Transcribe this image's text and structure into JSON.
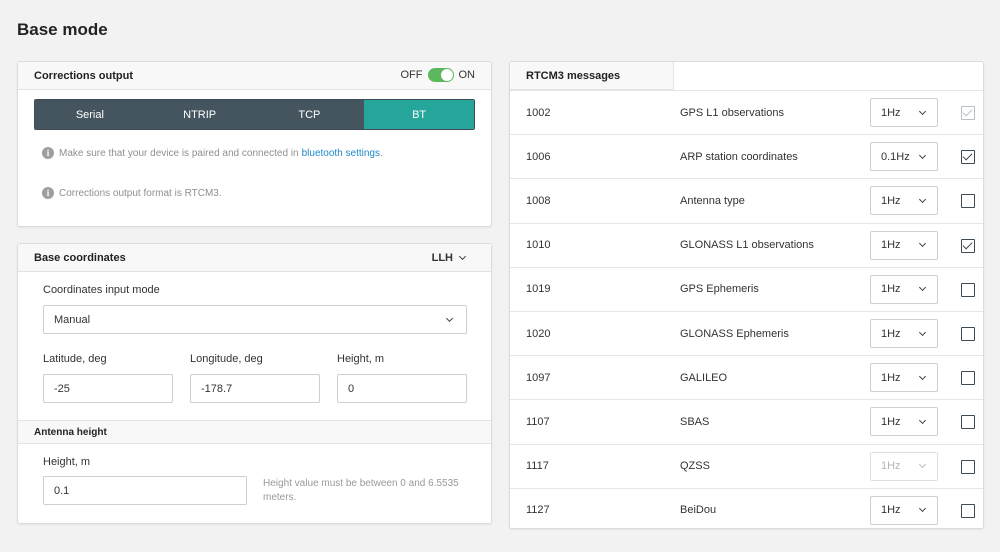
{
  "page": {
    "title": "Base mode"
  },
  "corrections": {
    "title": "Corrections output",
    "toggle_off": "OFF",
    "toggle_on": "ON",
    "tabs": [
      "Serial",
      "NTRIP",
      "TCP",
      "BT"
    ],
    "active_tab": "BT",
    "info1_text": "Make sure that your device is paired and connected in",
    "info1_link": "bluetooth settings",
    "info1_end": ".",
    "info2_text": "Corrections output format is RTCM3."
  },
  "coordinates": {
    "title": "Base coordinates",
    "format": "LLH",
    "input_mode_label": "Coordinates input mode",
    "input_mode_value": "Manual",
    "latitude_label": "Latitude, deg",
    "latitude_value": "-25",
    "longitude_label": "Longitude, deg",
    "longitude_value": "-178.7",
    "height_label": "Height, m",
    "height_value": "0"
  },
  "antenna": {
    "title": "Antenna height",
    "height_label": "Height, m",
    "height_value": "0.1",
    "hint": "Height value must be between 0 and 6.5535 meters."
  },
  "rtcm": {
    "title": "RTCM3 messages",
    "messages": [
      {
        "code": "1002",
        "name": "GPS L1 observations",
        "rate": "1Hz",
        "checked": true,
        "rate_disabled": false,
        "check_disabled": true
      },
      {
        "code": "1006",
        "name": "ARP station coordinates",
        "rate": "0.1Hz",
        "checked": true,
        "rate_disabled": false,
        "check_disabled": false
      },
      {
        "code": "1008",
        "name": "Antenna type",
        "rate": "1Hz",
        "checked": false,
        "rate_disabled": false,
        "check_disabled": false
      },
      {
        "code": "1010",
        "name": "GLONASS L1 observations",
        "rate": "1Hz",
        "checked": true,
        "rate_disabled": false,
        "check_disabled": false
      },
      {
        "code": "1019",
        "name": "GPS Ephemeris",
        "rate": "1Hz",
        "checked": false,
        "rate_disabled": false,
        "check_disabled": false
      },
      {
        "code": "1020",
        "name": "GLONASS Ephemeris",
        "rate": "1Hz",
        "checked": false,
        "rate_disabled": false,
        "check_disabled": false
      },
      {
        "code": "1097",
        "name": "GALILEO",
        "rate": "1Hz",
        "checked": false,
        "rate_disabled": false,
        "check_disabled": false
      },
      {
        "code": "1107",
        "name": "SBAS",
        "rate": "1Hz",
        "checked": false,
        "rate_disabled": false,
        "check_disabled": false
      },
      {
        "code": "1117",
        "name": "QZSS",
        "rate": "1Hz",
        "checked": false,
        "rate_disabled": true,
        "check_disabled": false
      },
      {
        "code": "1127",
        "name": "BeiDou",
        "rate": "1Hz",
        "checked": false,
        "rate_disabled": false,
        "check_disabled": false
      }
    ]
  },
  "colors": {
    "active_tab": "#26a69a",
    "tab": "#455560",
    "toggle_on": "#5cb85c",
    "link": "#1e88c7"
  }
}
